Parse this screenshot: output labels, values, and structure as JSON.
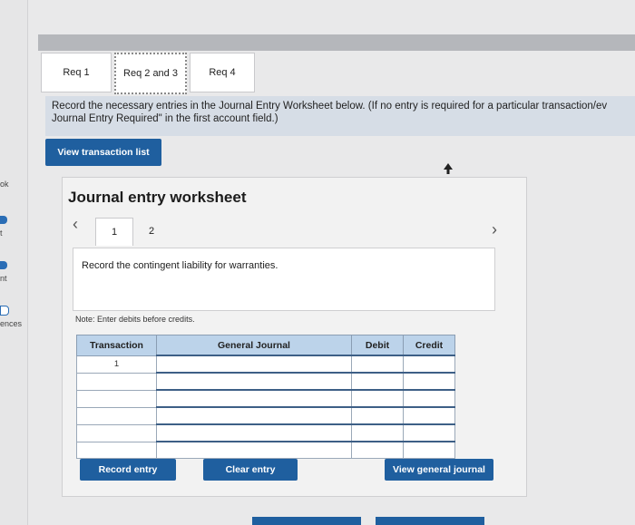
{
  "sidebar": {
    "labels": [
      "ok",
      "t",
      "nt",
      "ences"
    ]
  },
  "tabs": [
    {
      "label": "Req 1"
    },
    {
      "label": "Req 2 and 3",
      "active": true
    },
    {
      "label": "Req 4"
    }
  ],
  "instructions": {
    "line1": "Record the necessary entries in the Journal Entry Worksheet below. (If no entry is required for a particular transaction/ev",
    "line2": "Journal Entry Required\" in the first account field.)"
  },
  "view_transaction_list_label": "View transaction list",
  "worksheet": {
    "title": "Journal entry worksheet",
    "pages": [
      "1",
      "2"
    ],
    "prev_icon": "chevron-left-icon",
    "next_icon": "chevron-right-icon",
    "description": "Record the contingent liability for warranties.",
    "note": "Note: Enter debits before credits.",
    "table": {
      "headers": [
        "Transaction",
        "General Journal",
        "Debit",
        "Credit"
      ],
      "rows": [
        {
          "transaction": "1",
          "general_journal": "",
          "debit": "",
          "credit": ""
        },
        {
          "transaction": "",
          "general_journal": "",
          "debit": "",
          "credit": ""
        },
        {
          "transaction": "",
          "general_journal": "",
          "debit": "",
          "credit": ""
        },
        {
          "transaction": "",
          "general_journal": "",
          "debit": "",
          "credit": ""
        },
        {
          "transaction": "",
          "general_journal": "",
          "debit": "",
          "credit": ""
        },
        {
          "transaction": "",
          "general_journal": "",
          "debit": "",
          "credit": ""
        }
      ]
    },
    "buttons": {
      "record": "Record entry",
      "clear": "Clear entry",
      "view_journal": "View general journal"
    }
  },
  "colors": {
    "accent": "#1f5f9f",
    "header_bg": "#bcd3ea",
    "banner_bg": "#d6dde6"
  }
}
